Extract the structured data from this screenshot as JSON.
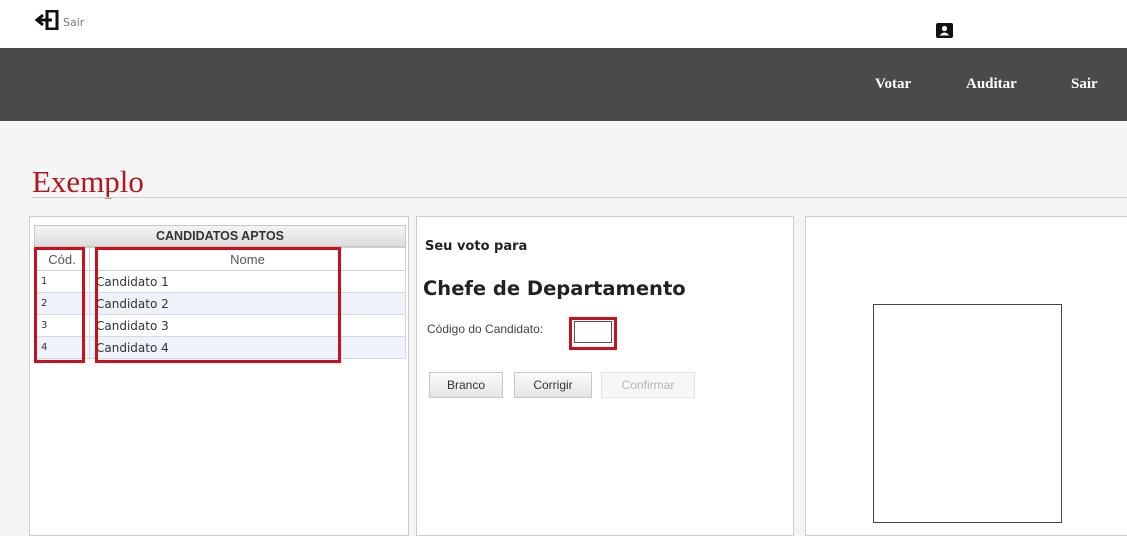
{
  "top": {
    "logout_label": "Sair",
    "logout_icon": "logout-arrow-icon",
    "account_icon": "account-card-icon"
  },
  "nav": {
    "items": [
      "Votar",
      "Auditar",
      "Sair"
    ]
  },
  "page": {
    "title": "Exemplo"
  },
  "candidates": {
    "caption": "CANDIDATOS APTOS",
    "columns": [
      "Cód.",
      "Nome"
    ],
    "rows": [
      {
        "code": "1",
        "name": "Candidato 1"
      },
      {
        "code": "2",
        "name": "Candidato 2"
      },
      {
        "code": "3",
        "name": "Candidato 3"
      },
      {
        "code": "4",
        "name": "Candidato 4"
      }
    ]
  },
  "vote": {
    "heading": "Seu voto para",
    "office": "Chefe de Departamento",
    "code_label": "Código do Candidato:",
    "code_value": "",
    "buttons": {
      "blank": "Branco",
      "correct": "Corrigir",
      "confirm": "Confirmar"
    }
  },
  "colors": {
    "accent_red": "#b0181e",
    "highlight_red": "#c8101e",
    "navbar": "#4a4a4a"
  }
}
